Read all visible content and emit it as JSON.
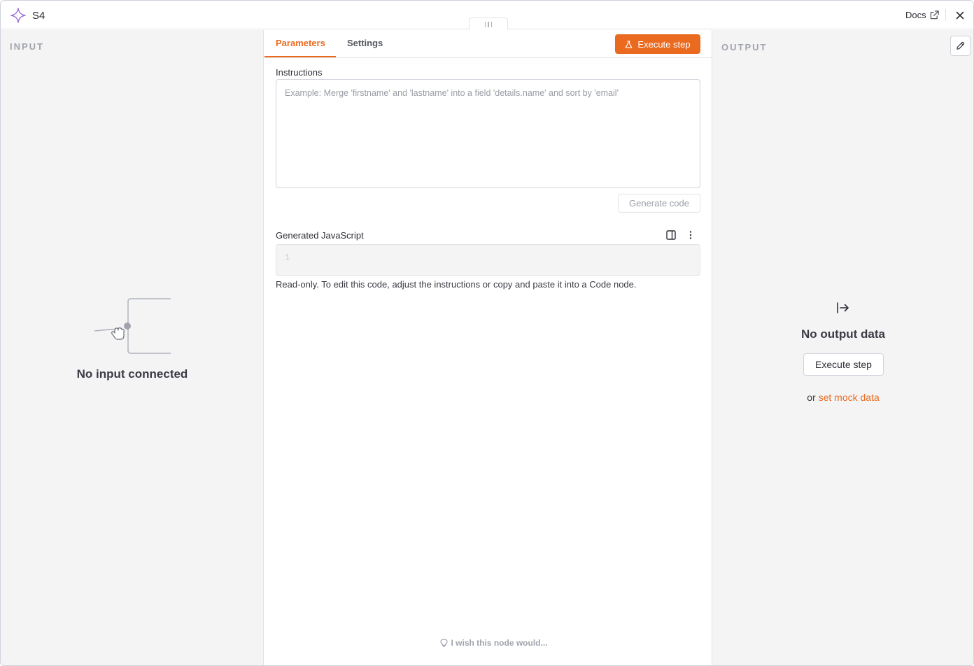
{
  "header": {
    "title": "S4",
    "docs_label": "Docs"
  },
  "input": {
    "title": "INPUT",
    "empty_text": "No input connected"
  },
  "main": {
    "tabs": [
      {
        "label": "Parameters",
        "active": true
      },
      {
        "label": "Settings",
        "active": false
      }
    ],
    "execute_label": "Execute step",
    "instructions_label": "Instructions",
    "instructions_placeholder": "Example: Merge 'firstname' and 'lastname' into a field 'details.name' and sort by 'email'",
    "instructions_value": "",
    "generate_label": "Generate code",
    "generated_label": "Generated JavaScript",
    "code_line_number": "1",
    "readonly_note": "Read-only. To edit this code, adjust the instructions or copy and paste it into a Code node.",
    "wish_label": "I wish this node would..."
  },
  "output": {
    "title": "OUTPUT",
    "empty_text": "No output data",
    "execute_label": "Execute step",
    "or_text": "or",
    "mock_label": "set mock data"
  },
  "colors": {
    "accent": "#ea6a1f",
    "node_icon": "#9b6bd6",
    "panel_bg": "#f4f4f5"
  }
}
